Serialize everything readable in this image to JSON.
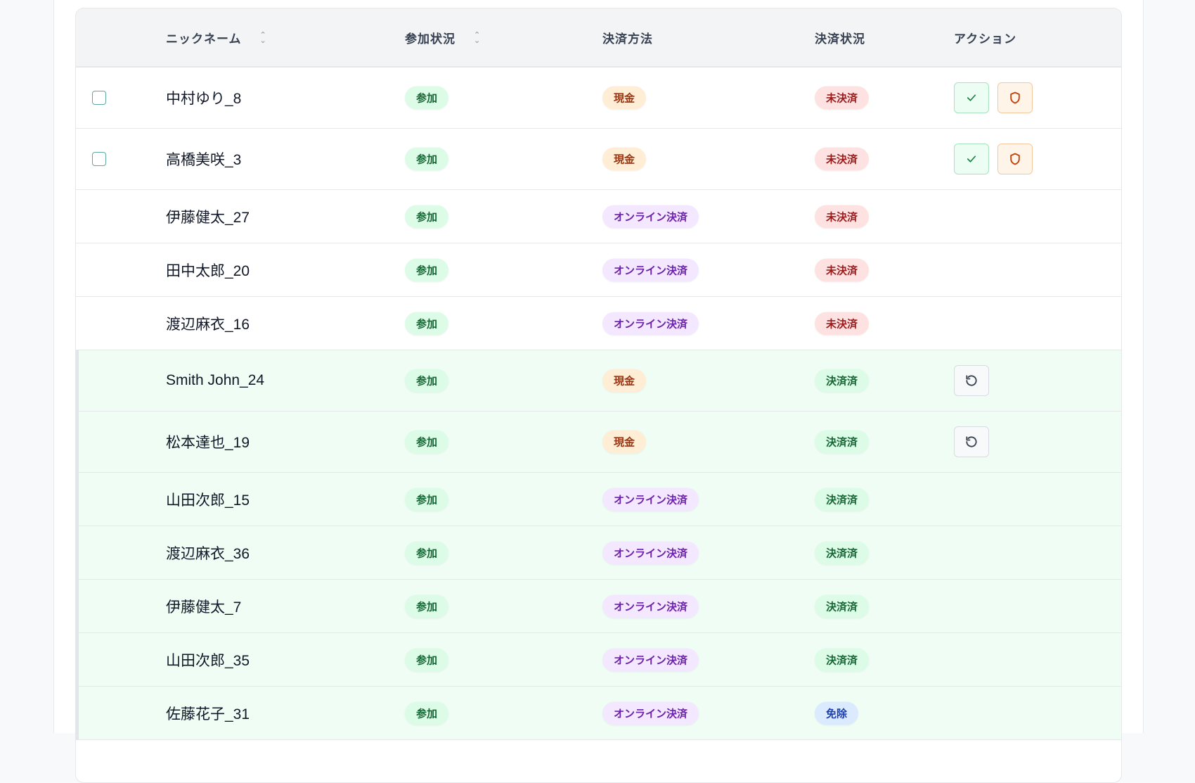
{
  "table": {
    "headers": {
      "nickname": "ニックネーム",
      "attendance": "参加状況",
      "payment_method": "決済方法",
      "payment_status": "決済状況",
      "actions": "アクション"
    },
    "rows": [
      {
        "nickname": "中村ゆり_8",
        "attendance": "参加",
        "payment_method": "現金",
        "payment_status": "未決済",
        "selectable": true,
        "actions": [
          "confirm",
          "exempt"
        ]
      },
      {
        "nickname": "高橋美咲_3",
        "attendance": "参加",
        "payment_method": "現金",
        "payment_status": "未決済",
        "selectable": true,
        "actions": [
          "confirm",
          "exempt"
        ]
      },
      {
        "nickname": "伊藤健太_27",
        "attendance": "参加",
        "payment_method": "オンライン決済",
        "payment_status": "未決済",
        "selectable": false,
        "actions": []
      },
      {
        "nickname": "田中太郎_20",
        "attendance": "参加",
        "payment_method": "オンライン決済",
        "payment_status": "未決済",
        "selectable": false,
        "actions": []
      },
      {
        "nickname": "渡辺麻衣_16",
        "attendance": "参加",
        "payment_method": "オンライン決済",
        "payment_status": "未決済",
        "selectable": false,
        "actions": []
      },
      {
        "nickname": "Smith John_24",
        "attendance": "参加",
        "payment_method": "現金",
        "payment_status": "決済済",
        "selectable": false,
        "actions": [
          "undo"
        ]
      },
      {
        "nickname": "松本達也_19",
        "attendance": "参加",
        "payment_method": "現金",
        "payment_status": "決済済",
        "selectable": false,
        "actions": [
          "undo"
        ]
      },
      {
        "nickname": "山田次郎_15",
        "attendance": "参加",
        "payment_method": "オンライン決済",
        "payment_status": "決済済",
        "selectable": false,
        "actions": []
      },
      {
        "nickname": "渡辺麻衣_36",
        "attendance": "参加",
        "payment_method": "オンライン決済",
        "payment_status": "決済済",
        "selectable": false,
        "actions": []
      },
      {
        "nickname": "伊藤健太_7",
        "attendance": "参加",
        "payment_method": "オンライン決済",
        "payment_status": "決済済",
        "selectable": false,
        "actions": []
      },
      {
        "nickname": "山田次郎_35",
        "attendance": "参加",
        "payment_method": "オンライン決済",
        "payment_status": "決済済",
        "selectable": false,
        "actions": []
      },
      {
        "nickname": "佐藤花子_31",
        "attendance": "参加",
        "payment_method": "オンライン決済",
        "payment_status": "免除",
        "selectable": false,
        "actions": []
      }
    ]
  },
  "badge_colors": {
    "参加": {
      "bg": "#dcfce7",
      "fg": "#166534"
    },
    "現金": {
      "bg": "#ffedd5",
      "fg": "#9a3412"
    },
    "オンライン決済": {
      "bg": "#f3e8ff",
      "fg": "#6b21a8"
    },
    "未決済": {
      "bg": "#fee2e2",
      "fg": "#991b1b"
    },
    "決済済": {
      "bg": "#dcfce7",
      "fg": "#166534"
    },
    "免除": {
      "bg": "#dbeafe",
      "fg": "#1e40af"
    }
  },
  "icons": {
    "confirm": "check-icon",
    "exempt": "shield-icon",
    "undo": "undo-icon",
    "sort": "sort-icon"
  }
}
